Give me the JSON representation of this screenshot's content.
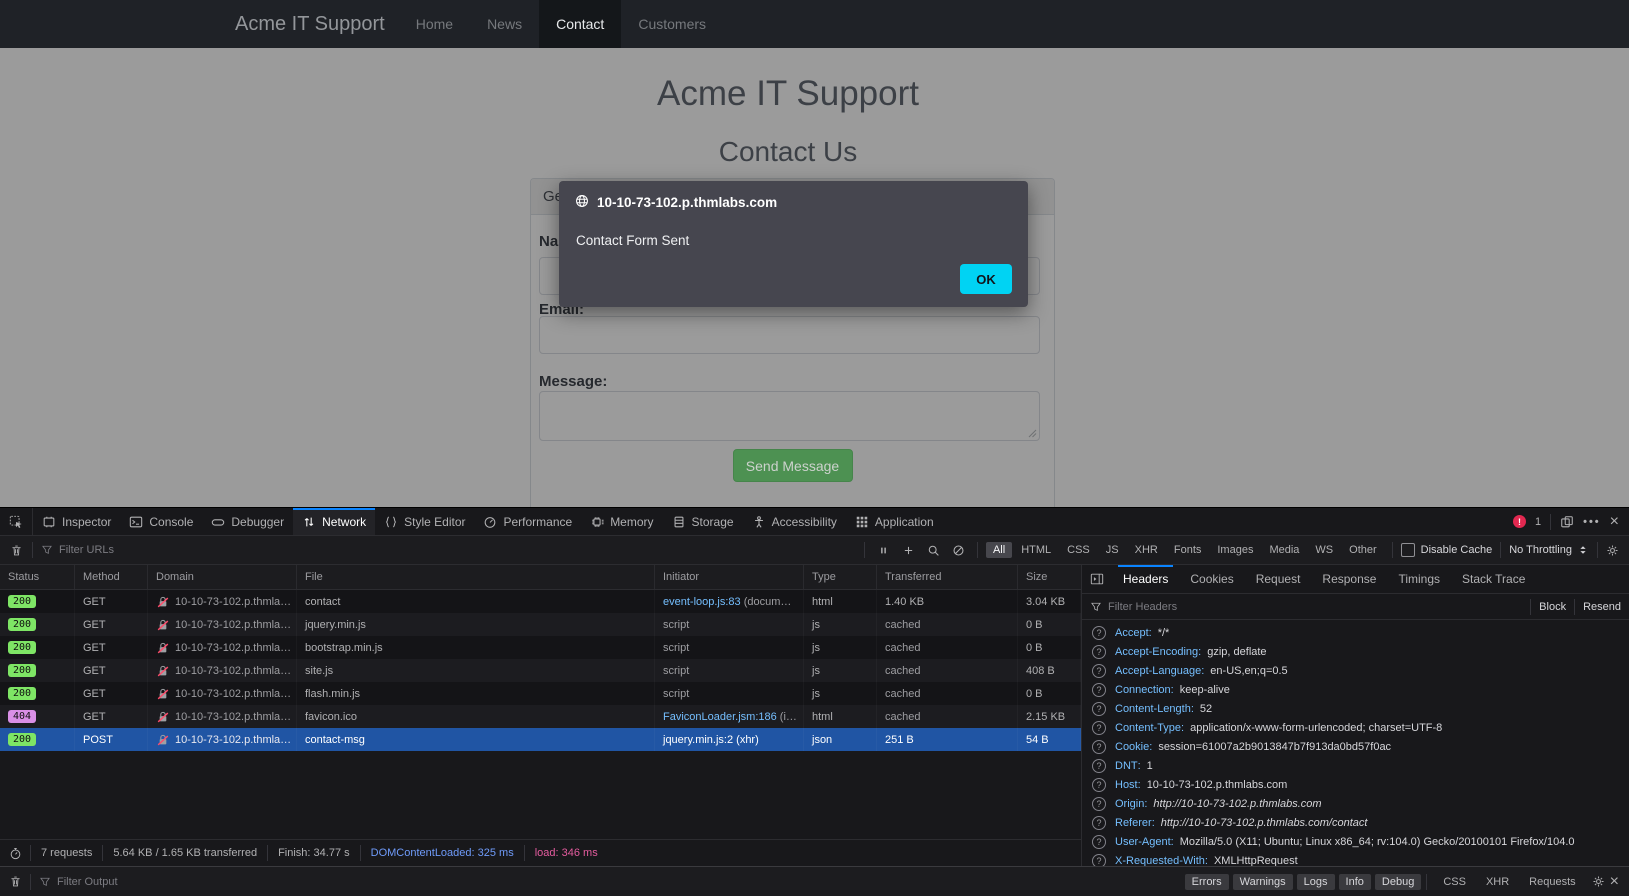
{
  "colors": {
    "accent": "#0a84ff",
    "selection": "#2055a4",
    "link": "#75bfff",
    "status_200_badge": "#7ee565",
    "status_404_badge": "#d98fe6",
    "ok_button": "#00d3f3",
    "send_button": "#4d9152",
    "dcl_text": "#6f9bfa",
    "load_text": "#e55c9f",
    "error_badge": "#e22850"
  },
  "page": {
    "navbar": {
      "brand": "Acme IT Support",
      "items": [
        {
          "label": "Home",
          "active": false
        },
        {
          "label": "News",
          "active": false
        },
        {
          "label": "Contact",
          "active": true
        },
        {
          "label": "Customers",
          "active": false
        }
      ]
    },
    "heading": "Acme IT Support",
    "subheading": "Contact Us",
    "form": {
      "header": "Get In Touch",
      "name_label": "Name:",
      "email_label": "Email:",
      "message_label": "Message:",
      "submit_label": "Send Message"
    },
    "dialog": {
      "host": "10-10-73-102.p.thmlabs.com",
      "message": "Contact Form Sent",
      "ok_label": "OK"
    }
  },
  "devtools": {
    "tabs": [
      {
        "label": "Inspector",
        "icon": "inspector",
        "active": false
      },
      {
        "label": "Console",
        "icon": "console",
        "active": false
      },
      {
        "label": "Debugger",
        "icon": "debugger",
        "active": false
      },
      {
        "label": "Network",
        "icon": "network",
        "active": true
      },
      {
        "label": "Style Editor",
        "icon": "style-editor",
        "active": false
      },
      {
        "label": "Performance",
        "icon": "performance",
        "active": false
      },
      {
        "label": "Memory",
        "icon": "memory",
        "active": false
      },
      {
        "label": "Storage",
        "icon": "storage",
        "active": false
      },
      {
        "label": "Accessibility",
        "icon": "accessibility",
        "active": false
      },
      {
        "label": "Application",
        "icon": "application",
        "active": false
      }
    ],
    "error_count": "1",
    "network_toolbar": {
      "filter_placeholder": "Filter URLs",
      "type_filters": [
        {
          "label": "All",
          "active": true
        },
        {
          "label": "HTML",
          "active": false
        },
        {
          "label": "CSS",
          "active": false
        },
        {
          "label": "JS",
          "active": false
        },
        {
          "label": "XHR",
          "active": false
        },
        {
          "label": "Fonts",
          "active": false
        },
        {
          "label": "Images",
          "active": false
        },
        {
          "label": "Media",
          "active": false
        },
        {
          "label": "WS",
          "active": false
        },
        {
          "label": "Other",
          "active": false
        }
      ],
      "disable_cache_label": "Disable Cache",
      "throttling_label": "No Throttling"
    },
    "request_table": {
      "columns": [
        "Status",
        "Method",
        "Domain",
        "File",
        "Initiator",
        "Type",
        "Transferred",
        "Size"
      ],
      "rows": [
        {
          "status": "200",
          "method": "GET",
          "domain": "10-10-73-102.p.thmla…",
          "file": "contact",
          "initiator_link": "event-loop.js:83",
          "initiator_rest": " (docum…",
          "type": "html",
          "transferred": "1.40 KB",
          "size": "3.04 KB",
          "selected": false
        },
        {
          "status": "200",
          "method": "GET",
          "domain": "10-10-73-102.p.thmla…",
          "file": "jquery.min.js",
          "initiator_link": "",
          "initiator_rest": "script",
          "type": "js",
          "transferred": "cached",
          "size": "0 B",
          "selected": false
        },
        {
          "status": "200",
          "method": "GET",
          "domain": "10-10-73-102.p.thmla…",
          "file": "bootstrap.min.js",
          "initiator_link": "",
          "initiator_rest": "script",
          "type": "js",
          "transferred": "cached",
          "size": "0 B",
          "selected": false
        },
        {
          "status": "200",
          "method": "GET",
          "domain": "10-10-73-102.p.thmla…",
          "file": "site.js",
          "initiator_link": "",
          "initiator_rest": "script",
          "type": "js",
          "transferred": "cached",
          "size": "408 B",
          "selected": false
        },
        {
          "status": "200",
          "method": "GET",
          "domain": "10-10-73-102.p.thmla…",
          "file": "flash.min.js",
          "initiator_link": "",
          "initiator_rest": "script",
          "type": "js",
          "transferred": "cached",
          "size": "0 B",
          "selected": false
        },
        {
          "status": "404",
          "method": "GET",
          "domain": "10-10-73-102.p.thmla…",
          "file": "favicon.ico",
          "initiator_link": "FaviconLoader.jsm:186",
          "initiator_rest": " (i…",
          "type": "html",
          "transferred": "cached",
          "size": "2.15 KB",
          "selected": false
        },
        {
          "status": "200",
          "method": "POST",
          "domain": "10-10-73-102.p.thmla…",
          "file": "contact-msg",
          "initiator_link": "jquery.min.js:2 (xhr)",
          "initiator_rest": "",
          "type": "json",
          "transferred": "251 B",
          "size": "54 B",
          "selected": true
        }
      ]
    },
    "details": {
      "tabs": [
        {
          "label": "Headers",
          "active": true
        },
        {
          "label": "Cookies",
          "active": false
        },
        {
          "label": "Request",
          "active": false
        },
        {
          "label": "Response",
          "active": false
        },
        {
          "label": "Timings",
          "active": false
        },
        {
          "label": "Stack Trace",
          "active": false
        }
      ],
      "filter_placeholder": "Filter Headers",
      "block_label": "Block",
      "resend_label": "Resend",
      "headers": [
        {
          "name": "Accept",
          "value": "*/*",
          "italic": false
        },
        {
          "name": "Accept-Encoding",
          "value": "gzip, deflate",
          "italic": false
        },
        {
          "name": "Accept-Language",
          "value": "en-US,en;q=0.5",
          "italic": false
        },
        {
          "name": "Connection",
          "value": "keep-alive",
          "italic": false
        },
        {
          "name": "Content-Length",
          "value": "52",
          "italic": false
        },
        {
          "name": "Content-Type",
          "value": "application/x-www-form-urlencoded; charset=UTF-8",
          "italic": false
        },
        {
          "name": "Cookie",
          "value": "session=61007a2b9013847b7f913da0bd57f0ac",
          "italic": false
        },
        {
          "name": "DNT",
          "value": "1",
          "italic": false
        },
        {
          "name": "Host",
          "value": "10-10-73-102.p.thmlabs.com",
          "italic": false
        },
        {
          "name": "Origin",
          "value": "http://10-10-73-102.p.thmlabs.com",
          "italic": true
        },
        {
          "name": "Referer",
          "value": "http://10-10-73-102.p.thmlabs.com/contact",
          "italic": true
        },
        {
          "name": "User-Agent",
          "value": "Mozilla/5.0 (X11; Ubuntu; Linux x86_64; rv:104.0) Gecko/20100101 Firefox/104.0",
          "italic": false
        },
        {
          "name": "X-Requested-With",
          "value": "XMLHttpRequest",
          "italic": false
        }
      ]
    },
    "summary": {
      "requests": "7 requests",
      "transferred": "5.64 KB / 1.65 KB transferred",
      "finish": "Finish: 34.77 s",
      "dom_content_loaded": "DOMContentLoaded: 325 ms",
      "load": "load: 346 ms"
    },
    "console_bar": {
      "filter_placeholder": "Filter Output",
      "buttons": [
        "Errors",
        "Warnings",
        "Logs",
        "Info",
        "Debug"
      ],
      "toggles": [
        "CSS",
        "XHR",
        "Requests"
      ]
    }
  }
}
